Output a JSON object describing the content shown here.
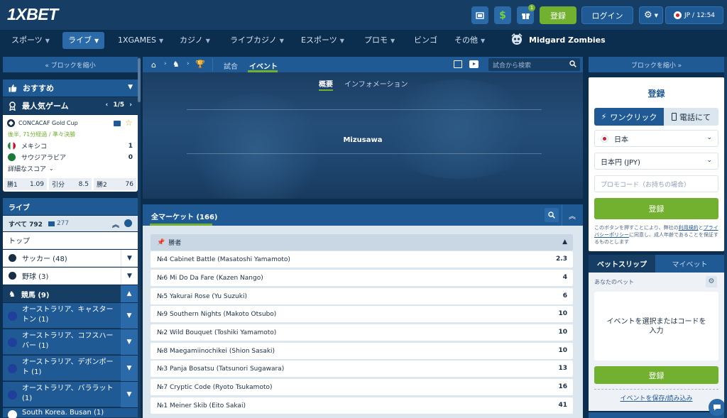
{
  "header": {
    "logo": "1XBET",
    "register_label": "登録",
    "login_label": "ログイン",
    "lang": "JP",
    "time": "12:54",
    "gift_badge": "1",
    "brand_color": "#1f5a95",
    "accent_green": "#72b02f"
  },
  "nav": {
    "items": [
      {
        "label": "スポーツ"
      },
      {
        "label": "ライブ"
      },
      {
        "label": "1XGAMES"
      },
      {
        "label": "カジノ"
      },
      {
        "label": "ライブカジノ"
      },
      {
        "label": "Eスポーツ"
      },
      {
        "label": "プロモ"
      },
      {
        "label": "ビンゴ"
      },
      {
        "label": "その他"
      }
    ],
    "promo_label": "Midgard Zombies"
  },
  "left": {
    "collapse_label": "« ブロックを縮小",
    "recommended_label": "おすすめ",
    "popular": {
      "title": "最人気ゲーム",
      "pager": "1/5",
      "league": "CONCACAF Gold Cup",
      "status": "後半, 71分経過 / 準々決勝",
      "team1": "メキシコ",
      "score1": "1",
      "team2": "サウジアラビア",
      "score2": "0",
      "details_label": "詳細なスコア",
      "odds": [
        {
          "label": "勝1",
          "value": "1.09"
        },
        {
          "label": "引分",
          "value": "8.5"
        },
        {
          "label": "勝2",
          "value": "76"
        }
      ]
    },
    "live": {
      "title": "ライブ",
      "all_label": "すべて 792",
      "video_count": "277",
      "top_label": "トップ",
      "sports": [
        {
          "label": "サッカー (48)"
        },
        {
          "label": "野球 (3)"
        }
      ],
      "racing_label": "競馬 (9)",
      "racing_items": [
        {
          "label": "オーストラリア、キャスタートン (1)"
        },
        {
          "label": "オーストラリア、コフスハーバー (1)"
        },
        {
          "label": "オーストラリア、デボンポート (1)"
        },
        {
          "label": "オーストラリア、バララット (1)"
        },
        {
          "label": "South Korea. Busan (1)"
        }
      ]
    }
  },
  "center": {
    "tab_match": "試合",
    "tab_event": "イベント",
    "search_placeholder": "試合から検索",
    "banner_tabs": [
      "概要",
      "インフォメーション"
    ],
    "venue": "Mizusawa",
    "markets_title": "全マーケット (166)",
    "group_title": "勝者",
    "markets": [
      {
        "name": "№4 Cabinet Battle (Masatoshi Yamamoto)",
        "odd": "2.3"
      },
      {
        "name": "№6 Mi Do Da Fare (Kazen Nango)",
        "odd": "4"
      },
      {
        "name": "№5 Yakurai Rose (Yu Suzuki)",
        "odd": "6"
      },
      {
        "name": "№9 Southern Nights (Makoto Otsubo)",
        "odd": "10"
      },
      {
        "name": "№2 Wild Bouquet (Toshiki Yamamoto)",
        "odd": "10"
      },
      {
        "name": "№8 Maegamiinochikei (Shion Sasaki)",
        "odd": "10"
      },
      {
        "name": "№3 Panja Bosatsu (Tatsunori Sugawara)",
        "odd": "13"
      },
      {
        "name": "№7 Cryptic Code (Ryoto Tsukamoto)",
        "odd": "16"
      },
      {
        "name": "№1 Meiner Skib (Eito Sakai)",
        "odd": "41"
      }
    ]
  },
  "right": {
    "collapse_label": "ブロックを縮小 »",
    "reg_title": "登録",
    "one_click_label": "ワンクリック",
    "phone_label": "電話にて",
    "country": "日本",
    "currency": "日本円 (JPY)",
    "promo_placeholder": "プロモコード（お持ちの場合）",
    "register_label": "登録",
    "terms_pre": "このボタンを押すことにより、弊社の",
    "terms_link1": "利用規約",
    "terms_mid": "と",
    "terms_link2": "プライバシーポリシー",
    "terms_post": "に同意し、成人年齢であることを保証するものとします",
    "betslip_tab": "ベットスリップ",
    "mybets_tab": "マイベット",
    "your_bet_label": "あなたのベット",
    "empty_msg": "イベントを選択またはコードを入力",
    "slip_register_label": "登録",
    "save_load_label": "イベントを保存/読み込み"
  }
}
